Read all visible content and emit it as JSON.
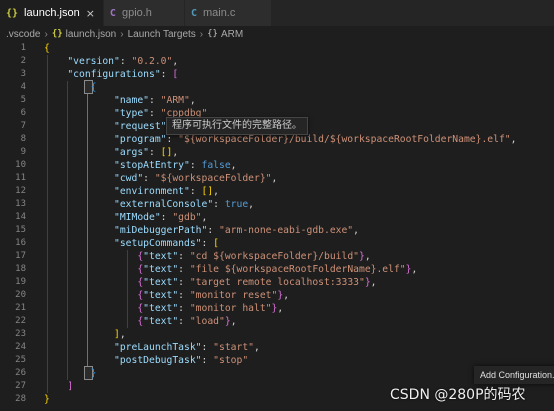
{
  "tabs": [
    {
      "label": "launch.json",
      "icon": "{}",
      "icon_color": "#cbcb41",
      "active": true,
      "close": "×"
    },
    {
      "label": "gpio.h",
      "icon": "C",
      "icon_color": "#a074c4",
      "active": false
    },
    {
      "label": "main.c",
      "icon": "C",
      "icon_color": "#519aba",
      "active": false
    }
  ],
  "breadcrumb": {
    "items": [
      ".vscode",
      "launch.json",
      "Launch Targets",
      "ARM"
    ],
    "icons": [
      "{}",
      "{}"
    ],
    "separator": "›"
  },
  "editor": {
    "lines": [
      [
        [
          "b1",
          "{"
        ]
      ],
      [
        [
          "p",
          "    "
        ],
        [
          "k",
          "\"version\""
        ],
        [
          "p",
          ": "
        ],
        [
          "s",
          "\"0.2.0\""
        ],
        [
          "p",
          ","
        ]
      ],
      [
        [
          "p",
          "    "
        ],
        [
          "k",
          "\"configurations\""
        ],
        [
          "p",
          ": "
        ],
        [
          "b2",
          "["
        ]
      ],
      [
        [
          "p",
          "        "
        ],
        [
          "b3",
          "{"
        ]
      ],
      [
        [
          "p",
          "            "
        ],
        [
          "k",
          "\"name\""
        ],
        [
          "p",
          ": "
        ],
        [
          "s",
          "\"ARM\""
        ],
        [
          "p",
          ","
        ]
      ],
      [
        [
          "p",
          "            "
        ],
        [
          "k",
          "\"type\""
        ],
        [
          "p",
          ": "
        ],
        [
          "s",
          "\"cppdbg\""
        ]
      ],
      [
        [
          "p",
          "            "
        ],
        [
          "k",
          "\"request\""
        ]
      ],
      [
        [
          "p",
          "            "
        ],
        [
          "k",
          "\"program\""
        ],
        [
          "p",
          ": "
        ],
        [
          "s",
          "\"${workspaceFolder}/build/${workspaceRootFolderName}.elf\""
        ],
        [
          "p",
          ","
        ]
      ],
      [
        [
          "p",
          "            "
        ],
        [
          "k",
          "\"args\""
        ],
        [
          "p",
          ": "
        ],
        [
          "b1",
          "[]"
        ],
        [
          "p",
          ","
        ]
      ],
      [
        [
          "p",
          "            "
        ],
        [
          "k",
          "\"stopAtEntry\""
        ],
        [
          "p",
          ": "
        ],
        [
          "bool",
          "false"
        ],
        [
          "p",
          ","
        ]
      ],
      [
        [
          "p",
          "            "
        ],
        [
          "k",
          "\"cwd\""
        ],
        [
          "p",
          ": "
        ],
        [
          "s",
          "\"${workspaceFolder}\""
        ],
        [
          "p",
          ","
        ]
      ],
      [
        [
          "p",
          "            "
        ],
        [
          "k",
          "\"environment\""
        ],
        [
          "p",
          ": "
        ],
        [
          "b1",
          "[]"
        ],
        [
          "p",
          ","
        ]
      ],
      [
        [
          "p",
          "            "
        ],
        [
          "k",
          "\"externalConsole\""
        ],
        [
          "p",
          ": "
        ],
        [
          "bool",
          "true"
        ],
        [
          "p",
          ","
        ]
      ],
      [
        [
          "p",
          "            "
        ],
        [
          "k",
          "\"MIMode\""
        ],
        [
          "p",
          ": "
        ],
        [
          "s",
          "\"gdb\""
        ],
        [
          "p",
          ","
        ]
      ],
      [
        [
          "p",
          "            "
        ],
        [
          "k",
          "\"miDebuggerPath\""
        ],
        [
          "p",
          ": "
        ],
        [
          "s",
          "\"arm-none-eabi-gdb.exe\""
        ],
        [
          "p",
          ","
        ]
      ],
      [
        [
          "p",
          "            "
        ],
        [
          "k",
          "\"setupCommands\""
        ],
        [
          "p",
          ": "
        ],
        [
          "b1",
          "["
        ]
      ],
      [
        [
          "p",
          "                "
        ],
        [
          "b2",
          "{"
        ],
        [
          "k",
          "\"text\""
        ],
        [
          "p",
          ": "
        ],
        [
          "s",
          "\"cd ${workspaceFolder}/build\""
        ],
        [
          "b2",
          "}"
        ],
        [
          "p",
          ","
        ]
      ],
      [
        [
          "p",
          "                "
        ],
        [
          "b2",
          "{"
        ],
        [
          "k",
          "\"text\""
        ],
        [
          "p",
          ": "
        ],
        [
          "s",
          "\"file ${workspaceRootFolderName}.elf\""
        ],
        [
          "b2",
          "}"
        ],
        [
          "p",
          ","
        ]
      ],
      [
        [
          "p",
          "                "
        ],
        [
          "b2",
          "{"
        ],
        [
          "k",
          "\"text\""
        ],
        [
          "p",
          ": "
        ],
        [
          "s",
          "\"target remote localhost:3333\""
        ],
        [
          "b2",
          "}"
        ],
        [
          "p",
          ","
        ]
      ],
      [
        [
          "p",
          "                "
        ],
        [
          "b2",
          "{"
        ],
        [
          "k",
          "\"text\""
        ],
        [
          "p",
          ": "
        ],
        [
          "s",
          "\"monitor reset\""
        ],
        [
          "b2",
          "}"
        ],
        [
          "p",
          ","
        ]
      ],
      [
        [
          "p",
          "                "
        ],
        [
          "b2",
          "{"
        ],
        [
          "k",
          "\"text\""
        ],
        [
          "p",
          ": "
        ],
        [
          "s",
          "\"monitor halt\""
        ],
        [
          "b2",
          "}"
        ],
        [
          "p",
          ","
        ]
      ],
      [
        [
          "p",
          "                "
        ],
        [
          "b2",
          "{"
        ],
        [
          "k",
          "\"text\""
        ],
        [
          "p",
          ": "
        ],
        [
          "s",
          "\"load\""
        ],
        [
          "b2",
          "}"
        ],
        [
          "p",
          ","
        ]
      ],
      [
        [
          "p",
          "            "
        ],
        [
          "b1",
          "]"
        ],
        [
          "p",
          ","
        ]
      ],
      [
        [
          "p",
          "            "
        ],
        [
          "k",
          "\"preLaunchTask\""
        ],
        [
          "p",
          ": "
        ],
        [
          "s",
          "\"start\""
        ],
        [
          "p",
          ","
        ]
      ],
      [
        [
          "p",
          "            "
        ],
        [
          "k",
          "\"postDebugTask\""
        ],
        [
          "p",
          ": "
        ],
        [
          "s",
          "\"stop\""
        ]
      ],
      [
        [
          "p",
          "        "
        ],
        [
          "b3",
          "}"
        ]
      ],
      [
        [
          "p",
          "    "
        ],
        [
          "b2",
          "]"
        ]
      ],
      [
        [
          "b1",
          "}"
        ]
      ]
    ]
  },
  "tooltip": {
    "text": "程序可执行文件的完整路径。"
  },
  "notification": {
    "text": "Add Configuration..."
  },
  "watermark": {
    "text": "CSDN @280P的码农"
  }
}
